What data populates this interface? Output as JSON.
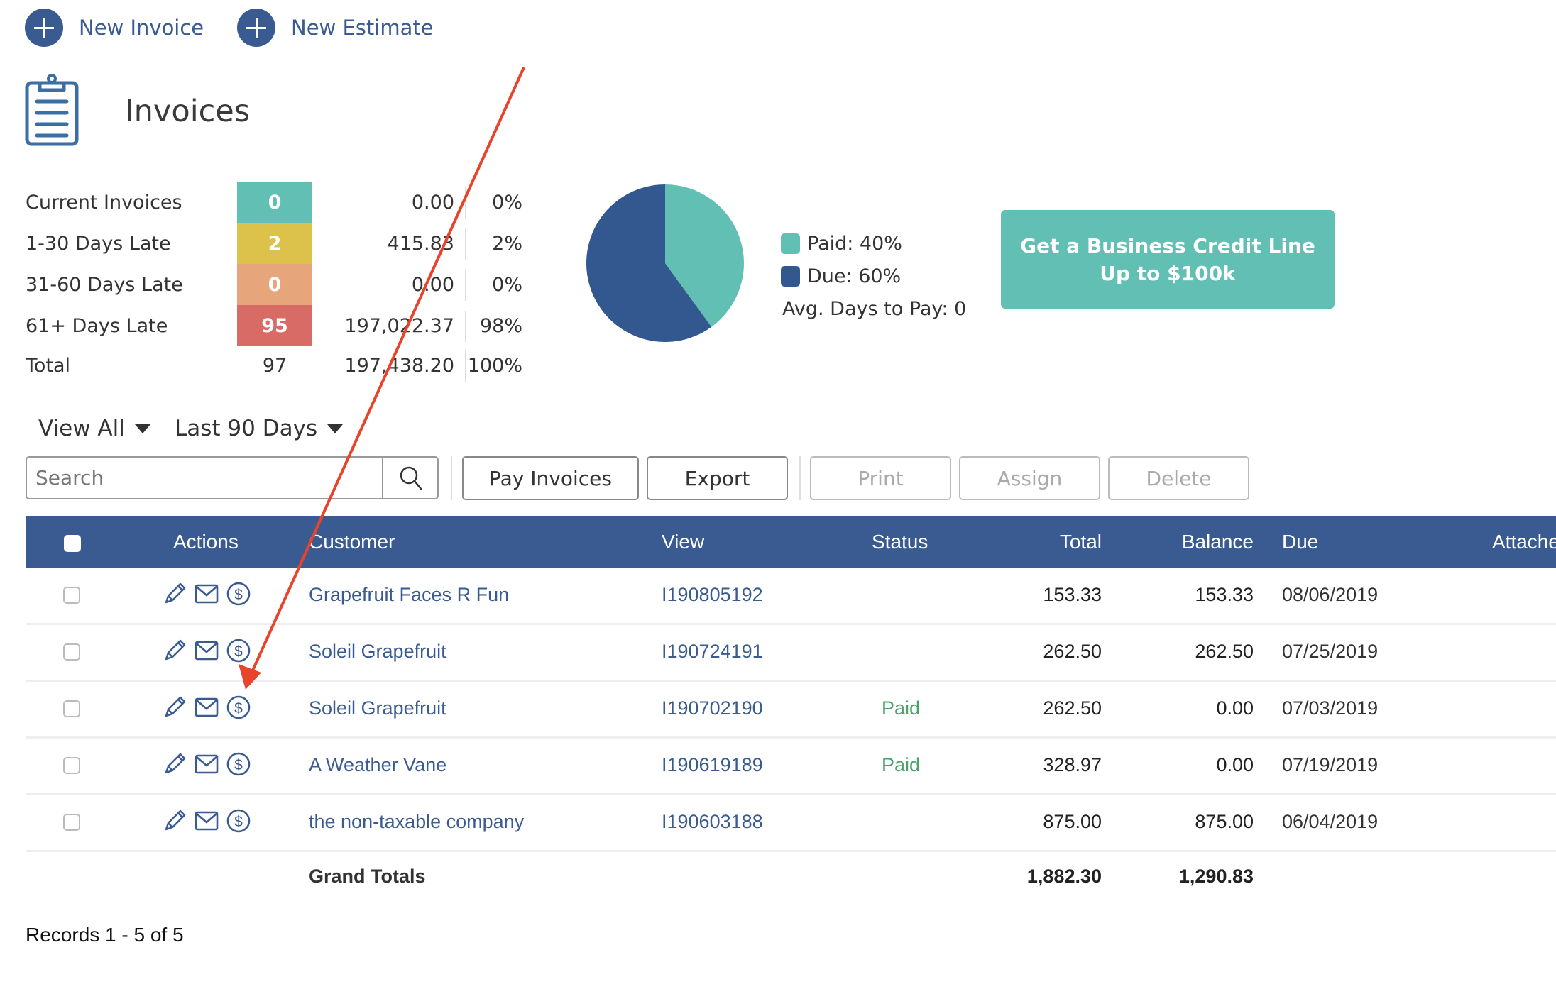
{
  "top_actions": {
    "new_invoice": "New Invoice",
    "new_estimate": "New Estimate"
  },
  "page": {
    "title": "Invoices",
    "icon": "clipboard-icon"
  },
  "aging": {
    "rows": [
      {
        "label": "Current Invoices",
        "count": "0",
        "amount": "0.00",
        "percent": "0%",
        "color": "#62bfb3"
      },
      {
        "label": "1-30 Days Late",
        "count": "2",
        "amount": "415.83",
        "percent": "2%",
        "color": "#dcc24b"
      },
      {
        "label": "31-60 Days Late",
        "count": "0",
        "amount": "0.00",
        "percent": "0%",
        "color": "#e6a57b"
      },
      {
        "label": "61+ Days Late",
        "count": "95",
        "amount": "197,022.37",
        "percent": "98%",
        "color": "#d96b66"
      }
    ],
    "total": {
      "label": "Total",
      "count": "97",
      "amount": "197,438.20",
      "percent": "100%"
    }
  },
  "chart_data": {
    "type": "pie",
    "title": "",
    "slices": [
      {
        "label": "Paid",
        "value": 40,
        "color": "#62bfb3"
      },
      {
        "label": "Due",
        "value": 60,
        "color": "#33588f"
      }
    ],
    "legend": [
      "Paid: 40%",
      "Due: 60%"
    ],
    "legend_position": "right"
  },
  "summary": {
    "legend_paid": "Paid: 40%",
    "legend_due": "Due: 60%",
    "avg_days": "Avg. Days to Pay: 0"
  },
  "promo": {
    "line1": "Get a Business Credit Line",
    "line2": "Up to $100k"
  },
  "filters": {
    "view": "View All",
    "range": "Last 90 Days"
  },
  "toolbar": {
    "search_placeholder": "Search",
    "search_value": "",
    "pay_invoices": "Pay Invoices",
    "export": "Export",
    "print": "Print",
    "assign": "Assign",
    "delete": "Delete"
  },
  "table": {
    "columns": [
      "Actions",
      "Customer",
      "View",
      "Status",
      "Total",
      "Balance",
      "Due",
      "Attache"
    ],
    "rows": [
      {
        "customer": "Grapefruit Faces R Fun",
        "view": "I190805192",
        "status": "",
        "total": "153.33",
        "balance": "153.33",
        "due": "08/06/2019"
      },
      {
        "customer": "Soleil Grapefruit",
        "view": "I190724191",
        "status": "",
        "total": "262.50",
        "balance": "262.50",
        "due": "07/25/2019"
      },
      {
        "customer": "Soleil Grapefruit",
        "view": "I190702190",
        "status": "Paid",
        "total": "262.50",
        "balance": "0.00",
        "due": "07/03/2019"
      },
      {
        "customer": "A Weather Vane",
        "view": "I190619189",
        "status": "Paid",
        "total": "328.97",
        "balance": "0.00",
        "due": "07/19/2019"
      },
      {
        "customer": "the non-taxable company",
        "view": "I190603188",
        "status": "",
        "total": "875.00",
        "balance": "875.00",
        "due": "06/04/2019"
      }
    ],
    "grand_totals": {
      "label": "Grand Totals",
      "total": "1,882.30",
      "balance": "1,290.83"
    }
  },
  "footer": {
    "records": "Records 1 - 5 of 5"
  },
  "colors": {
    "brand_blue": "#3a5b92",
    "teal": "#62bfb3",
    "paid_green": "#4aa36c",
    "annotation_red": "#e8432b"
  }
}
